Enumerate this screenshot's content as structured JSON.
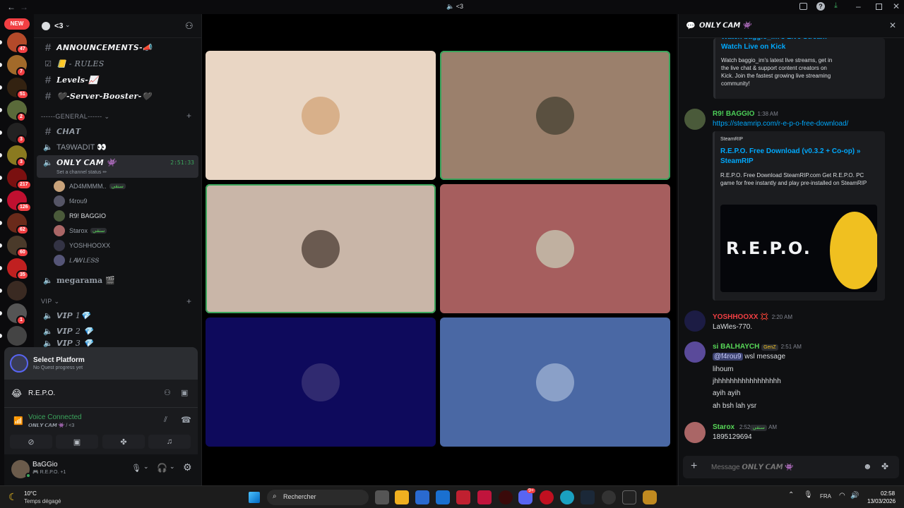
{
  "titlebar": {
    "title": "<3",
    "back_icon": "back-arrow",
    "icons": [
      "inbox-icon",
      "help-icon",
      "download-icon",
      "minimize",
      "maximize",
      "close"
    ]
  },
  "servers": {
    "new_label": "NEW",
    "items": [
      {
        "badge": "47",
        "color": "#b44a2a"
      },
      {
        "badge": "7",
        "color": "#a26a2a"
      },
      {
        "badge": "51",
        "color": "#332211"
      },
      {
        "badge": "2",
        "color": "#5a6a3a"
      },
      {
        "badge": "3",
        "color": "#222"
      },
      {
        "badge": "3",
        "color": "#8a7a20"
      },
      {
        "badge": "217",
        "color": "#7a1010"
      },
      {
        "badge": "126",
        "color": "#c01030"
      },
      {
        "badge": "62",
        "color": "#6a2a1a"
      },
      {
        "badge": "60",
        "color": "#4a3a2a"
      },
      {
        "badge": "35",
        "color": "#c02020"
      },
      {
        "badge": "",
        "color": "#3a2a22"
      },
      {
        "badge": "1",
        "color": "#555"
      },
      {
        "badge": "",
        "color": "#444"
      }
    ]
  },
  "guild": {
    "name": "<3"
  },
  "channels": {
    "top": [
      {
        "name": "𝘼𝙉𝙉𝙊𝙐𝙉𝘾𝙀𝙈𝙀𝙉𝙏𝙎-📣",
        "icon": "hash"
      },
      {
        "name": "📒 - 𝑅𝑈𝐿𝐸𝑆",
        "icon": "rules"
      },
      {
        "name": "Levels-📈",
        "icon": "hash"
      },
      {
        "name": "🖤-Server-Booster-🖤",
        "icon": "hash"
      }
    ],
    "general_label": "------GENERAL------",
    "general": [
      {
        "name": "𝘾𝙃𝘼𝙏",
        "icon": "hash"
      },
      {
        "name": "TA9WADIT 👀",
        "icon": "speaker"
      },
      {
        "name": "𝙊𝙉𝙇𝙔 𝘾𝘼𝙈 👾",
        "icon": "speaker",
        "timer": "2:51:33",
        "status": "Set a channel status ✏"
      }
    ],
    "voice_users": [
      {
        "name": "AD4MMMM..",
        "tag": "سنقي",
        "color": "#c8a27a"
      },
      {
        "name": "f4rou9",
        "tag": "",
        "color": "#556"
      },
      {
        "name": "R9! BAGGIO",
        "tag": "",
        "color": "#4a5a3a"
      },
      {
        "name": "Starox",
        "tag": "سنقي",
        "color": "#a66"
      },
      {
        "name": "YOSHHOOXX",
        "tag": "",
        "color": "#334"
      },
      {
        "name": "𝐿𝐴𝑊𝐿𝐸𝑆𝑆",
        "tag": "",
        "color": "#557"
      }
    ],
    "other": {
      "name": "megarama 🎬"
    },
    "vip_label": "VIP",
    "vip": [
      {
        "name": "𝙑𝙄𝙋 1💎"
      },
      {
        "name": "𝙑𝙄𝙋 2 💎"
      },
      {
        "name": "𝙑𝙄𝙋 3 💎"
      }
    ]
  },
  "quest": {
    "title": "Select Platform",
    "subtitle": "No Quest progress yet"
  },
  "activity": {
    "name": "R.E.P.O."
  },
  "voice": {
    "status": "Voice Connected",
    "channel": "𝙊𝙉𝙇𝙔 𝘾𝘼𝙈 👾 / <3"
  },
  "me": {
    "name": "BaGGio",
    "status": "🎮 R.E.P.O. +1"
  },
  "stage_tiles": [
    {
      "bg": "#e9d6c4",
      "speaking": false,
      "avcolor": "#d8b08a"
    },
    {
      "bg": "#9b806c",
      "speaking": true,
      "avcolor": "#5a5040"
    },
    {
      "bg": "#c9b6a8",
      "speaking": true,
      "avcolor": "#6a5a50"
    },
    {
      "bg": "#a65e5e",
      "speaking": false,
      "avcolor": "#c0b0a0"
    },
    {
      "bg": "#0e0a5c",
      "speaking": false,
      "avcolor": "#302a70"
    },
    {
      "bg": "#4a68a4",
      "speaking": false,
      "avcolor": "#8aa0c8"
    }
  ],
  "chat": {
    "header": "𝙊𝙉𝙇𝙔 𝘾𝘼𝙈 👾",
    "embed1": {
      "title": "Watch baggio_im's Live Stream - Watch Live on Kick",
      "desc": "Watch baggio_im's latest live streams, get in the live chat & support content creators on Kick. Join the fastest growing live streaming community!"
    },
    "messages": [
      {
        "user": "R9! BAGGIO",
        "color": "#4ccf58",
        "time": "1:38 AM",
        "text": "https://steamrip.com/r-e-p-o-free-download/",
        "link": true
      },
      {
        "user": "YOSHHOOXX 💢",
        "color": "#f23f43",
        "time": "2:20 AM",
        "text": "LaWles-770."
      },
      {
        "user": "si BALHAYCH",
        "tag": "GenZ",
        "color": "#58d858",
        "time": "2:51 AM",
        "mention": "@f4rou9",
        "text": "wsl message",
        "lines": [
          "lihoum",
          "jhhhhhhhhhhhhhhhhh",
          "ayih ayih",
          "ah bsh lah ysr"
        ]
      },
      {
        "user": "Starox",
        "tag": "سنقي",
        "color": "#58d858",
        "time": "2:52 AM",
        "text": "1895129694"
      }
    ],
    "embed2": {
      "site": "SteamRIP",
      "title": "R.E.P.O. Free Download (v0.3.2 + Co-op) » SteamRIP",
      "desc": "R.E.P.O. Free Download SteamRIP.com Get R.E.P.O. PC game for free instantly and play pre-installed on SteamRIP",
      "image_text": "R.E.P.O."
    },
    "input_placeholder": "Message 𝙊𝙉𝙇𝙔 𝘾𝘼𝙈 👾"
  },
  "taskbar": {
    "weather_temp": "10°C",
    "weather_desc": "Temps dégagé",
    "search_placeholder": "Rechercher",
    "lang": "FRA",
    "time": "02:58",
    "date": "13/03/2026",
    "discord_badge": "9+"
  }
}
